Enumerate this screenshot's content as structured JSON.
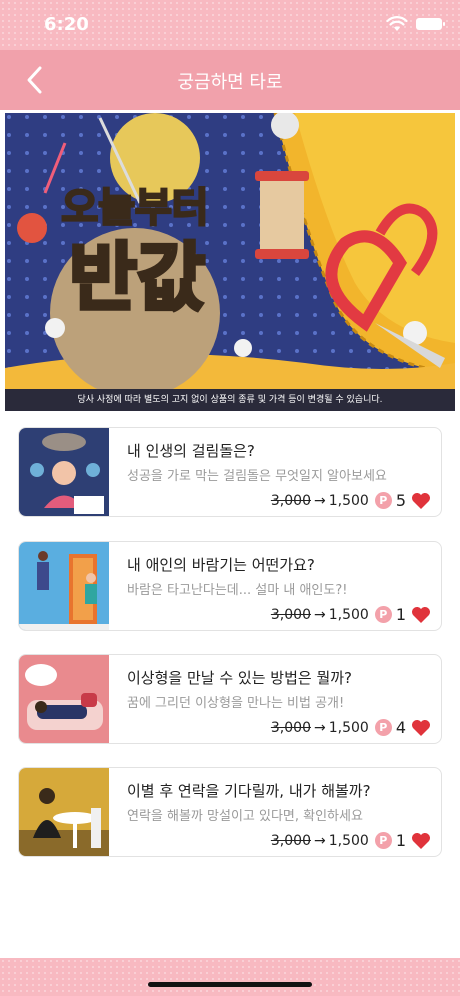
{
  "status_bar": {
    "time": "6:20"
  },
  "nav": {
    "title": "궁금하면 타로",
    "back_icon": "chevron-left-icon"
  },
  "banner": {
    "title_line1": "오늘부터",
    "title_line2": "반값",
    "notice": "당사 사정에 따라 별도의 고지 없이 상품의 종류 및 가격 등이 변경될 수 있습니다."
  },
  "colors": {
    "header": "#f1a1ab",
    "status": "#f8b9c1",
    "heart": "#e0333b",
    "badge": "#f3a1aa"
  },
  "items": [
    {
      "title": "내 인생의 걸림돌은?",
      "description": "성공을 가로 막는 걸림돌은 무엇일지 알아보세요",
      "old_price": "3,000",
      "arrow": "→",
      "new_price": "1,500",
      "point_label": "P",
      "likes": "5"
    },
    {
      "title": "내 애인의 바람기는 어떤가요?",
      "description": "바람은 타고난다는데... 설마 내 애인도?!",
      "old_price": "3,000",
      "arrow": "→",
      "new_price": "1,500",
      "point_label": "P",
      "likes": "1"
    },
    {
      "title": "이상형을 만날 수 있는 방법은 뭘까?",
      "description": "꿈에 그리던 이상형을 만나는 비법 공개!",
      "old_price": "3,000",
      "arrow": "→",
      "new_price": "1,500",
      "point_label": "P",
      "likes": "4"
    },
    {
      "title": "이별 후 연락을 기다릴까, 내가 해볼까?",
      "description": "연락을 해볼까 망설이고 있다면, 확인하세요",
      "old_price": "3,000",
      "arrow": "→",
      "new_price": "1,500",
      "point_label": "P",
      "likes": "1"
    }
  ]
}
